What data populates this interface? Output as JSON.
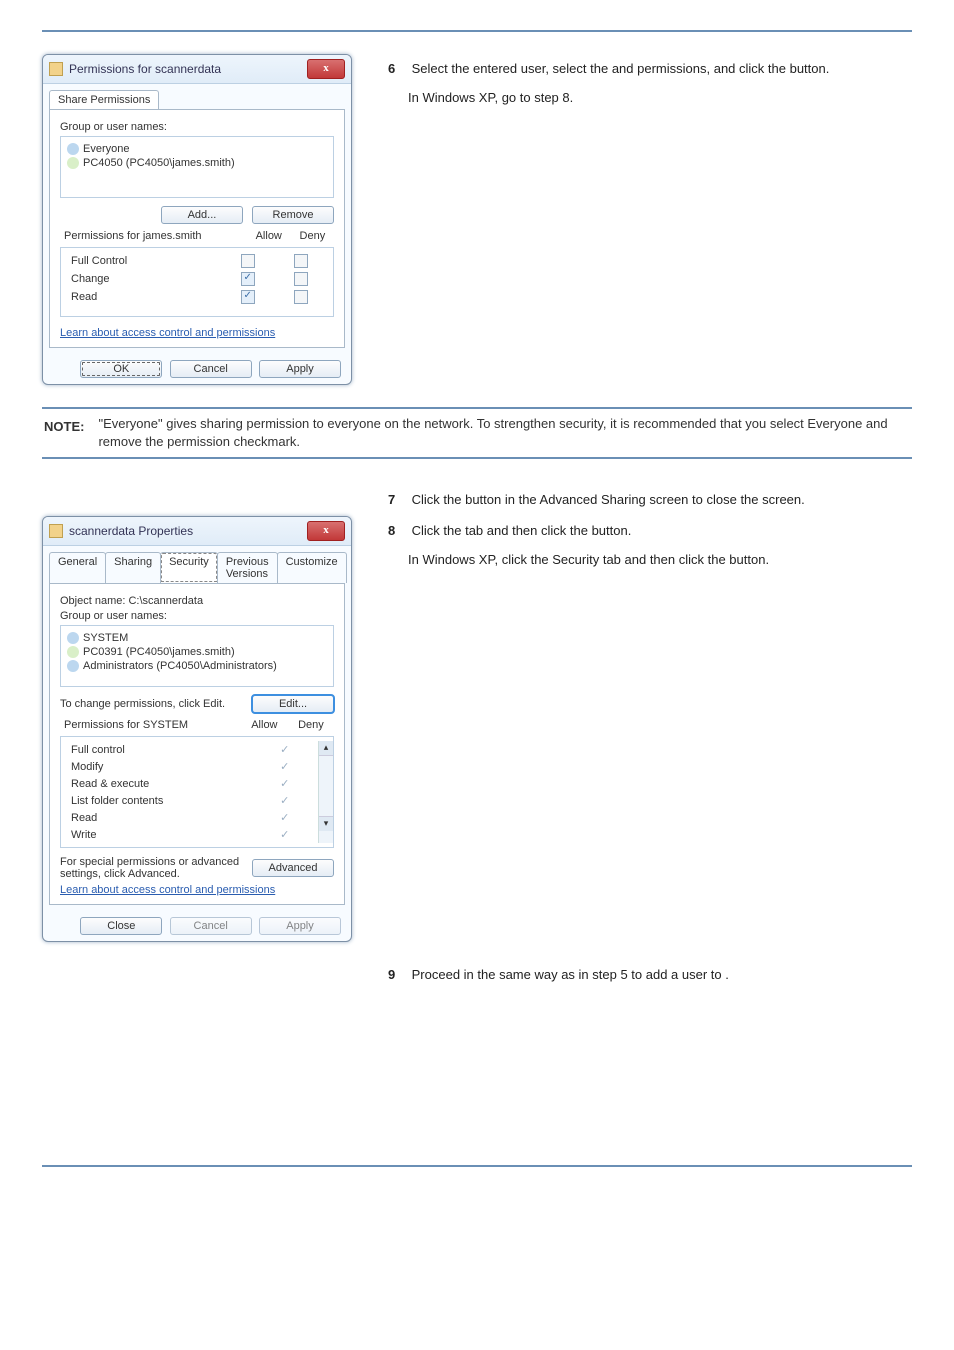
{
  "dlg1": {
    "title": "Permissions for scannerdata",
    "tab": "Share Permissions",
    "groupLabel": "Group or user names:",
    "users": [
      "Everyone",
      "PC4050 (PC4050\\james.smith)"
    ],
    "addBtn": "Add...",
    "removeBtn": "Remove",
    "permForLabel": "Permissions for james.smith",
    "allow": "Allow",
    "deny": "Deny",
    "rows": [
      "Full Control",
      "Change",
      "Read"
    ],
    "link": "Learn about access control and permissions",
    "ok": "OK",
    "cancel": "Cancel",
    "apply": "Apply"
  },
  "step6": {
    "l1a": "Select the entered user, select the ",
    "l1b": " and",
    "l2a": " permissions, and click the ",
    "l2b": " button.",
    "l3": "In Windows XP, go to step 8."
  },
  "note": {
    "label": "NOTE:",
    "text": "\"Everyone\" gives sharing permission to everyone on the network. To strengthen security, it is recommended that you select Everyone and remove the            permission checkmark."
  },
  "step7": {
    "l1a": "Click the ",
    "l1b": " button in the Advanced Sharing screen to close the screen."
  },
  "step8": {
    "l1a": "Click the ",
    "l1b": " tab and then click the ",
    "l1c": " button.",
    "l2": "In Windows XP, click the Security tab and then click the            button."
  },
  "dlg2": {
    "title": "scannerdata Properties",
    "tabs": [
      "General",
      "Sharing",
      "Security",
      "Previous Versions",
      "Customize"
    ],
    "objLabel": "Object name:    C:\\scannerdata",
    "groupLabel": "Group or user names:",
    "users": [
      "SYSTEM",
      "PC0391 (PC4050\\james.smith)",
      "Administrators (PC4050\\Administrators)"
    ],
    "changeLabel": "To change permissions, click Edit.",
    "editBtn": "Edit...",
    "permForLabel": "Permissions for SYSTEM",
    "allow": "Allow",
    "deny": "Deny",
    "rows": [
      "Full control",
      "Modify",
      "Read & execute",
      "List folder contents",
      "Read",
      "Write"
    ],
    "specialLabel": "For special permissions or advanced settings, click Advanced.",
    "advBtn": "Advanced",
    "link": "Learn about access control and permissions",
    "close": "Close",
    "cancel": "Cancel",
    "apply": "Apply"
  },
  "step9": {
    "l1": "Proceed in the same way as in step 5 to add a user to                                    ."
  },
  "nums": {
    "s6": "6",
    "s7": "7",
    "s8": "8",
    "s9": "9"
  }
}
